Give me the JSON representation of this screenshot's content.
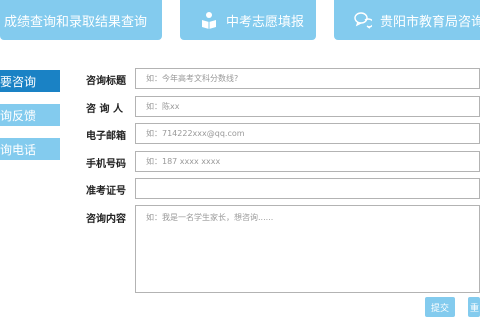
{
  "tabs": [
    {
      "label": "成绩查询和录取结果查询"
    },
    {
      "label": "中考志愿填报",
      "icon": "book-reader-icon"
    },
    {
      "label": "贵阳市教育局咨询入",
      "icon": "chat-bubbles-icon"
    }
  ],
  "sidebar": {
    "items": [
      {
        "label": "要咨询"
      },
      {
        "label": "询反馈"
      },
      {
        "label": "询电话"
      }
    ]
  },
  "form": {
    "subject_label": "咨询标题",
    "subject_placeholder": "如：今年高考文科分数线?",
    "name_label": "咨 询 人",
    "name_placeholder": "如：陈xx",
    "email_label": "电子邮箱",
    "email_placeholder": "如：714222xxx@qq.com",
    "phone_label": "手机号码",
    "phone_placeholder": "如：187 xxxx xxxx",
    "ticket_label": "准考证号",
    "ticket_placeholder": "",
    "content_label": "咨询内容",
    "content_placeholder": "如：我是一名学生家长，想咨询......",
    "submit_label": "提交",
    "reset_label": "重"
  },
  "colors": {
    "tab_bg": "#83cbee",
    "sidebar_active": "#1a82c5",
    "text_white": "#ffffff"
  }
}
